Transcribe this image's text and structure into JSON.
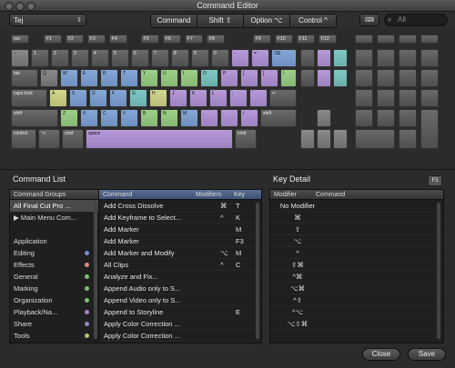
{
  "window": {
    "title": "Command Editor"
  },
  "toolbar": {
    "command_set": "Tej",
    "modifiers": [
      "Command",
      "Shift ⇧",
      "Option ⌥",
      "Control ^"
    ],
    "keyboard_button": "⌨",
    "search_placeholder": "All"
  },
  "keyboard": {
    "fn_row": [
      "esc",
      "F1",
      "F2",
      "F3",
      "F4",
      "F5",
      "F6",
      "F7",
      "F8",
      "F9",
      "F10",
      "F11",
      "F12"
    ],
    "labels": {
      "tab": "tab",
      "caps": "caps lock",
      "shift_l": "shift",
      "shift_r": "shift",
      "control": "control",
      "option": "⌥",
      "cmd_l": "cmd",
      "cmd_r": "cmd",
      "space": "space",
      "delete": "⌫",
      "return": "↵"
    },
    "number_row": [
      "~",
      "1",
      "2",
      "3",
      "4",
      "5",
      "6",
      "7",
      "8",
      "9",
      "0",
      "-",
      "="
    ],
    "qwerty": [
      "Q",
      "W",
      "E",
      "R",
      "T",
      "Y",
      "U",
      "I",
      "O",
      "P",
      "[",
      "]",
      "\\"
    ],
    "asdf": [
      "A",
      "S",
      "D",
      "F",
      "G",
      "H",
      "J",
      "K",
      "L",
      ";",
      "'"
    ],
    "zxcv": [
      "Z",
      "X",
      "C",
      "V",
      "B",
      "N",
      "M",
      ",",
      ".",
      "/"
    ]
  },
  "command_list": {
    "heading": "Command List",
    "groups_header": "Command Groups",
    "groups": [
      {
        "label": "All Final Cut Pro ...",
        "color": ""
      },
      {
        "label": "▶ Main Menu Com...",
        "color": ""
      },
      {
        "label": "",
        "color": ""
      },
      {
        "label": "Application",
        "color": ""
      },
      {
        "label": "Editing",
        "color": "#6f8fd0"
      },
      {
        "label": "Effects",
        "color": "#d88a70"
      },
      {
        "label": "General",
        "color": "#7fc070"
      },
      {
        "label": "Marking",
        "color": "#7fc070"
      },
      {
        "label": "Organization",
        "color": "#7fc070"
      },
      {
        "label": "Playback/Na...",
        "color": "#9c80c0"
      },
      {
        "label": "Share",
        "color": "#9c80c0"
      },
      {
        "label": "Tools",
        "color": "#bcbf72"
      }
    ],
    "columns": [
      "Command",
      "Modifiers",
      "Key"
    ],
    "rows": [
      {
        "cmd": "Add Cross Dissolve",
        "mod": "⌘",
        "key": "T"
      },
      {
        "cmd": "Add Keyframe to Select...",
        "mod": "^",
        "key": "K"
      },
      {
        "cmd": "Add Marker",
        "mod": "",
        "key": "M"
      },
      {
        "cmd": "Add Marker",
        "mod": "",
        "key": "F3"
      },
      {
        "cmd": "Add Marker and Modify",
        "mod": "⌥",
        "key": "M"
      },
      {
        "cmd": "All Clips",
        "mod": "^",
        "key": "C"
      },
      {
        "cmd": "Analyze and Fix...",
        "mod": "",
        "key": ""
      },
      {
        "cmd": "Append Audio only to S...",
        "mod": "",
        "key": ""
      },
      {
        "cmd": "Append Video only to S...",
        "mod": "",
        "key": ""
      },
      {
        "cmd": "Append to Storyline",
        "mod": "",
        "key": "E"
      },
      {
        "cmd": "Apply Color Correction ...",
        "mod": "",
        "key": ""
      },
      {
        "cmd": "Apply Color Correction ...",
        "mod": "",
        "key": ""
      }
    ]
  },
  "key_detail": {
    "heading": "Key Detail",
    "badge": "F3",
    "columns": [
      "Modifier",
      "Command"
    ],
    "rows": [
      "No Modifier",
      "⌘",
      "⇧",
      "⌥",
      "^",
      "⇧⌘",
      "^⌘",
      "⌥⌘",
      "^⇧",
      "^⌥",
      "⌥⇧⌘"
    ]
  },
  "footer": {
    "close": "Close",
    "save": "Save"
  }
}
